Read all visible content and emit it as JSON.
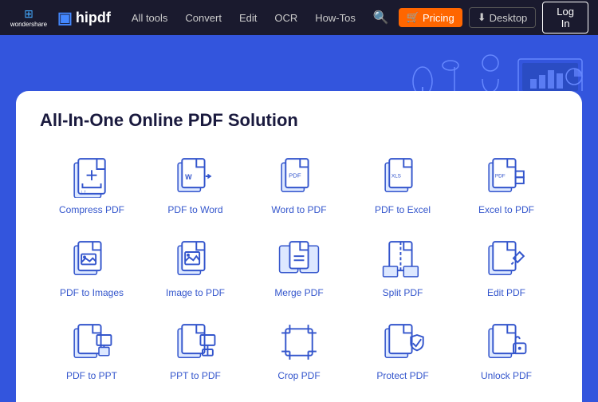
{
  "navbar": {
    "wondershare_label": "wondershare",
    "hipdf_label": "hipdf",
    "links": [
      {
        "label": "All tools",
        "id": "all-tools"
      },
      {
        "label": "Convert",
        "id": "convert"
      },
      {
        "label": "Edit",
        "id": "edit"
      },
      {
        "label": "OCR",
        "id": "ocr"
      },
      {
        "label": "How-Tos",
        "id": "how-tos"
      }
    ],
    "pricing_label": "Pricing",
    "desktop_label": "Desktop",
    "login_label": "Log In"
  },
  "hero": {
    "title": "All-In-One Online PDF Solution"
  },
  "tools": [
    {
      "label": "Compress PDF",
      "icon": "compress"
    },
    {
      "label": "PDF to Word",
      "icon": "pdf-to-word"
    },
    {
      "label": "Word to PDF",
      "icon": "word-to-pdf"
    },
    {
      "label": "PDF to Excel",
      "icon": "pdf-to-excel"
    },
    {
      "label": "Excel to PDF",
      "icon": "excel-to-pdf"
    },
    {
      "label": "PDF to Images",
      "icon": "pdf-to-images"
    },
    {
      "label": "Image to PDF",
      "icon": "image-to-pdf"
    },
    {
      "label": "Merge PDF",
      "icon": "merge-pdf"
    },
    {
      "label": "Split PDF",
      "icon": "split-pdf"
    },
    {
      "label": "Edit PDF",
      "icon": "edit-pdf"
    },
    {
      "label": "PDF to PPT",
      "icon": "pdf-to-ppt"
    },
    {
      "label": "PPT to PDF",
      "icon": "ppt-to-pdf"
    },
    {
      "label": "Crop PDF",
      "icon": "crop-pdf"
    },
    {
      "label": "Protect PDF",
      "icon": "protect-pdf"
    },
    {
      "label": "Unlock PDF",
      "icon": "unlock-pdf"
    }
  ]
}
